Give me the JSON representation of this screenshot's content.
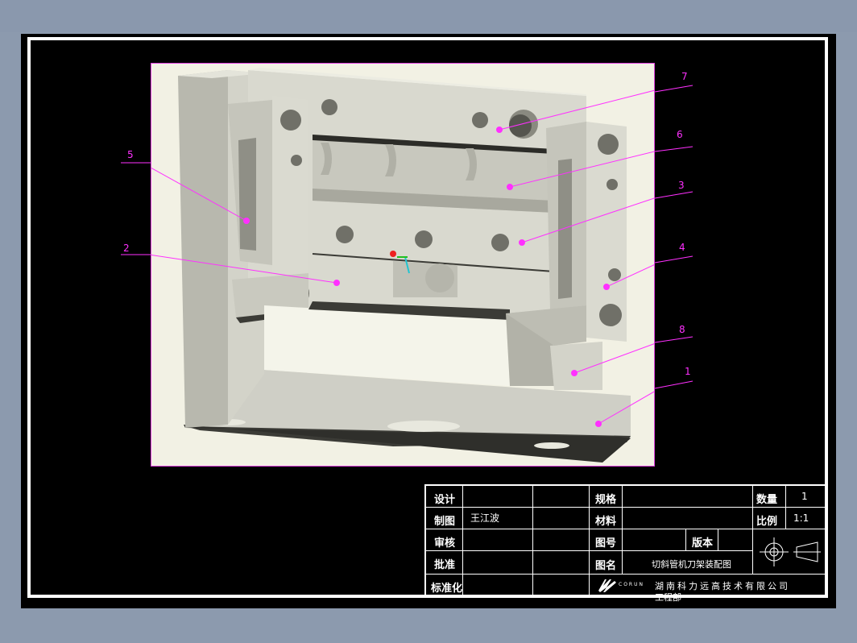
{
  "callouts": [
    {
      "id": "7",
      "label": "7"
    },
    {
      "id": "6",
      "label": "6"
    },
    {
      "id": "5",
      "label": "5"
    },
    {
      "id": "3",
      "label": "3"
    },
    {
      "id": "2",
      "label": "2"
    },
    {
      "id": "4",
      "label": "4"
    },
    {
      "id": "8",
      "label": "8"
    },
    {
      "id": "1",
      "label": "1"
    }
  ],
  "title_block": {
    "design_label": "设计",
    "drawn_label": "制图",
    "drawn_by": "王江波",
    "check_label": "审核",
    "approve_label": "批准",
    "standard_label": "标准化",
    "spec_label": "规格",
    "material_label": "材料",
    "drawing_no_label": "图号",
    "version_label": "版本",
    "drawing_name_label": "图名",
    "drawing_name": "切斜管机刀架装配图",
    "quantity_label": "数量",
    "quantity": "1",
    "scale_label": "比例",
    "scale": "1:1",
    "company_logo_text": "CORUN",
    "company_name": "湖南科力远高技术有限公司",
    "company_dept": "工程部"
  },
  "colors": {
    "callout": "#ff30ff",
    "model_face": "#c9c9bf",
    "model_dark": "#3a3a34",
    "viewport_bg": "#f2f1e4"
  }
}
